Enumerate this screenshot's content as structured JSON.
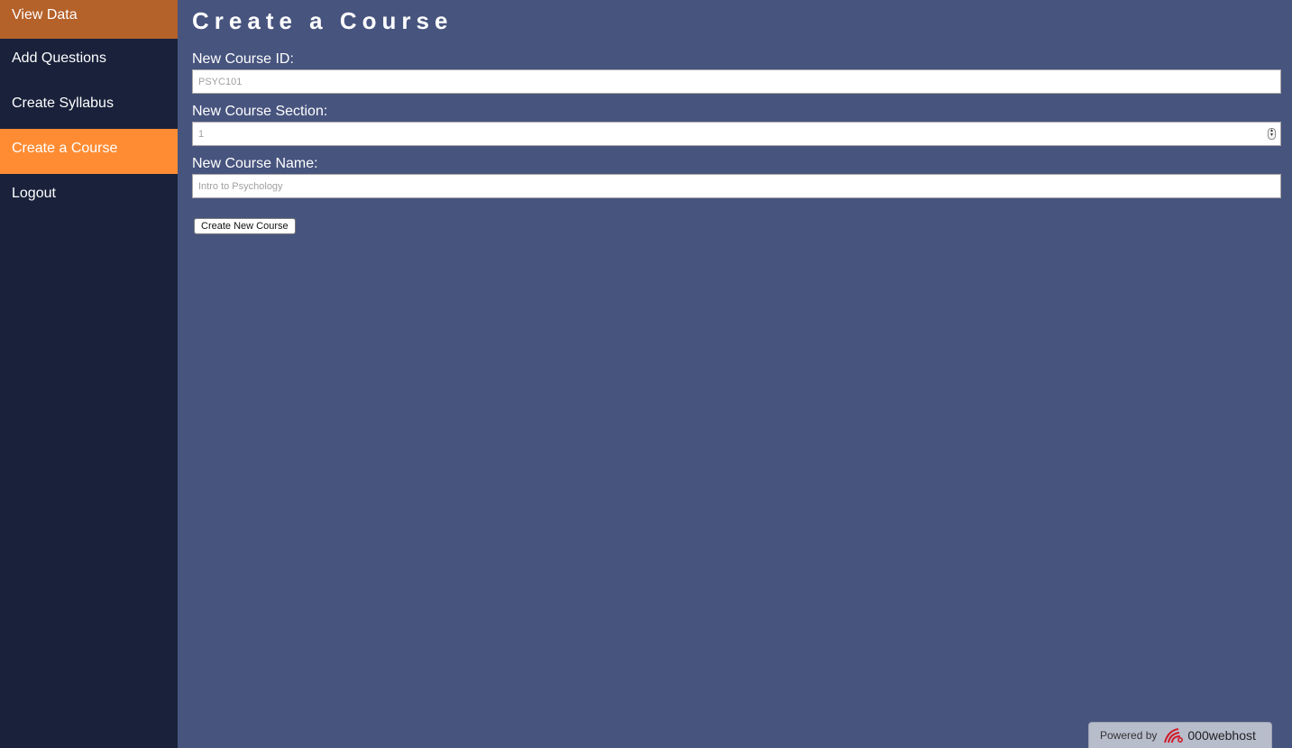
{
  "sidebar": {
    "items": [
      {
        "label": "View Data",
        "state": "hover"
      },
      {
        "label": "Add Questions",
        "state": "normal"
      },
      {
        "label": "Create Syllabus",
        "state": "normal"
      },
      {
        "label": "Create a Course",
        "state": "active"
      },
      {
        "label": "Logout",
        "state": "normal"
      }
    ]
  },
  "main": {
    "title": "Create a Course",
    "fields": {
      "course_id": {
        "label": "New Course ID:",
        "placeholder": "PSYC101",
        "value": ""
      },
      "course_section": {
        "label": "New Course Section:",
        "placeholder": "1",
        "value": ""
      },
      "course_name": {
        "label": "New Course Name:",
        "placeholder": "Intro to Psychology",
        "value": ""
      }
    },
    "submit_label": "Create New Course"
  },
  "footer_badge": {
    "prefix": "Powered by",
    "brand": "000webhost",
    "icon": "000webhost-logo-icon"
  },
  "colors": {
    "sidebar_bg": "#19213b",
    "main_bg": "#47547e",
    "active_item": "#ff8c33",
    "hover_item": "#b5612a"
  }
}
